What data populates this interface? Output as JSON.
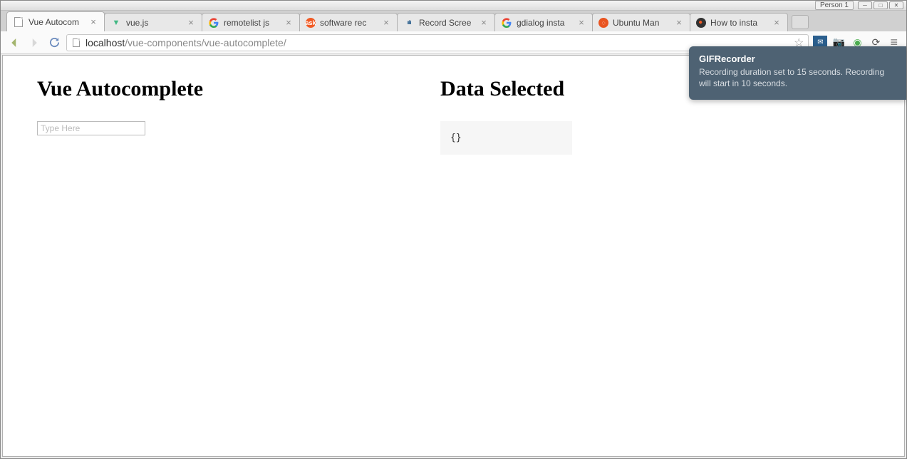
{
  "window": {
    "profile": "Person 1"
  },
  "tabs": [
    {
      "title": "Vue Autocom",
      "active": true,
      "favicon": "page"
    },
    {
      "title": "vue.js",
      "active": false,
      "favicon": "vue"
    },
    {
      "title": "remotelist js",
      "active": false,
      "favicon": "google"
    },
    {
      "title": "software rec",
      "active": false,
      "favicon": "ask"
    },
    {
      "title": "Record Scree",
      "active": false,
      "favicon": "rec"
    },
    {
      "title": "gdialog insta",
      "active": false,
      "favicon": "google"
    },
    {
      "title": "Ubuntu Man",
      "active": false,
      "favicon": "ubuntu"
    },
    {
      "title": "How to insta",
      "active": false,
      "favicon": "dark"
    }
  ],
  "address": {
    "host": "localhost",
    "path": "/vue-components/vue-autocomplete/"
  },
  "page": {
    "left_heading": "Vue Autocomplete",
    "right_heading": "Data Selected",
    "input_placeholder": "Type Here",
    "data_selected": "{}"
  },
  "notification": {
    "title": "GIFRecorder",
    "body": "Recording duration set to 15 seconds. Recording will start in 10 seconds."
  }
}
